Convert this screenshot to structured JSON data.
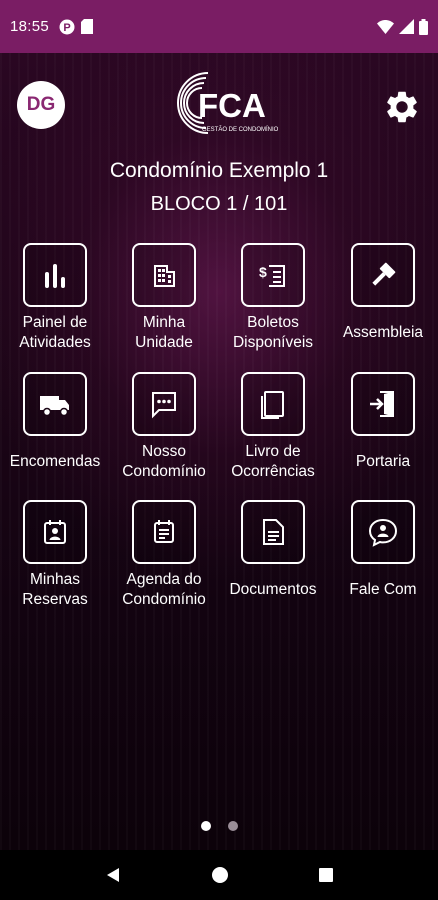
{
  "status_bar": {
    "time": "18:55",
    "left_icons": [
      "pinterest-like-icon",
      "sim-card-icon"
    ],
    "right_icons": [
      "wifi-icon",
      "signal-icon",
      "battery-icon"
    ],
    "color": "#7a1d64"
  },
  "header": {
    "avatar_initials": "DG",
    "logo_text": "FCA",
    "logo_subtitle": "GESTÃO DE CONDOMÍNIO",
    "settings_icon": "gear-icon"
  },
  "condo": {
    "name": "Condomínio Exemplo 1",
    "unit": "BLOCO 1 / 101"
  },
  "tiles": [
    {
      "label": "Painel de\nAtividades",
      "icon": "bar-chart-icon"
    },
    {
      "label": "Minha\nUnidade",
      "icon": "building-icon"
    },
    {
      "label": "Boletos\nDisponíveis",
      "icon": "invoice-icon"
    },
    {
      "label": "Assembleia",
      "icon": "gavel-icon"
    },
    {
      "label": "Encomendas",
      "icon": "truck-icon"
    },
    {
      "label": "Nosso\nCondomínio",
      "icon": "chat-icon"
    },
    {
      "label": "Livro de\nOcorrências",
      "icon": "book-icon"
    },
    {
      "label": "Portaria",
      "icon": "door-enter-icon"
    },
    {
      "label": "Minhas\nReservas",
      "icon": "calendar-person-icon"
    },
    {
      "label": "Agenda do\nCondomínio",
      "icon": "calendar-icon"
    },
    {
      "label": "Documentos",
      "icon": "document-icon"
    },
    {
      "label": "Fale Com",
      "icon": "support-chat-icon"
    }
  ],
  "pager": {
    "pages": 2,
    "active": 1
  },
  "nav": [
    "back-icon",
    "home-icon",
    "recents-icon"
  ],
  "colors": {
    "accent": "#7a1d64",
    "avatar_text": "#8a2872"
  }
}
